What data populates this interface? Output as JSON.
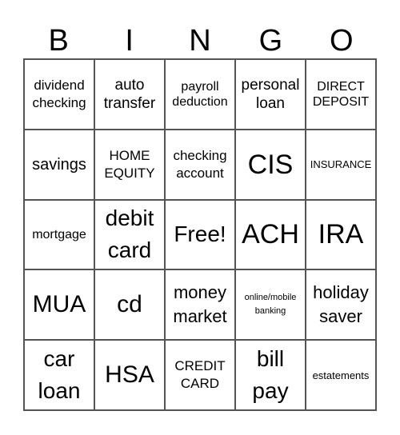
{
  "header": [
    "B",
    "I",
    "N",
    "G",
    "O"
  ],
  "cells": [
    "dividend checking",
    "auto transfer",
    "payroll deduction",
    "personal loan",
    "DIRECT DEPOSIT",
    "savings",
    "HOME EQUITY",
    "checking account",
    "CIS",
    "INSURANCE",
    "mortgage",
    "debit card",
    "Free!",
    "ACH",
    "IRA",
    "MUA",
    "cd",
    "money market",
    "online/mobile banking",
    "holiday saver",
    "car loan",
    "HSA",
    "CREDIT CARD",
    "bill pay",
    "estatements"
  ]
}
